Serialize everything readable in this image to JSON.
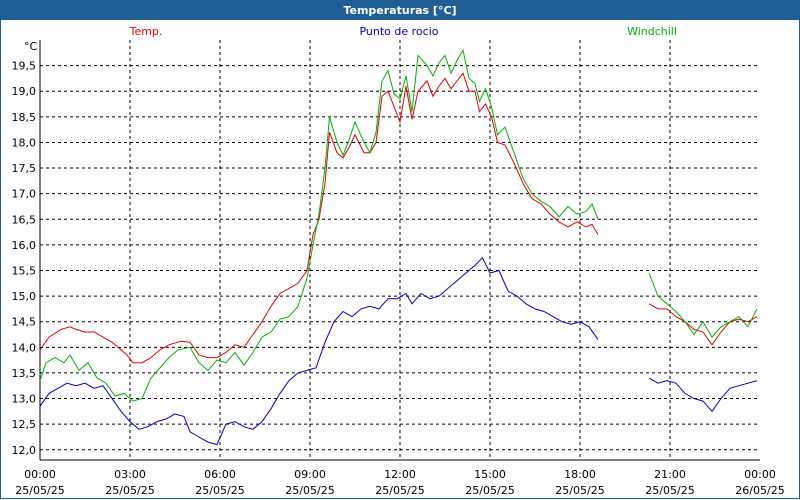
{
  "window": {
    "title": "Temperaturas [°C]"
  },
  "chart_data": {
    "type": "line",
    "title": "Temperaturas [°C]",
    "ylabel": "°C",
    "ylim": [
      11.8,
      20.0
    ],
    "y_ticks": [
      12.0,
      12.5,
      13.0,
      13.5,
      14.0,
      14.5,
      15.0,
      15.5,
      16.0,
      16.5,
      17.0,
      17.5,
      18.0,
      18.5,
      19.0,
      19.5
    ],
    "y_tick_labels": [
      "12,0",
      "12,5",
      "13,0",
      "13,5",
      "14,0",
      "14,5",
      "15,0",
      "15,5",
      "16,0",
      "16,5",
      "17,0",
      "17,5",
      "18,0",
      "18,5",
      "19,0",
      "19,5"
    ],
    "xlim": [
      0,
      24
    ],
    "x_ticks": [
      {
        "h": 0,
        "time": "00:00",
        "date": "25/05/25"
      },
      {
        "h": 3,
        "time": "03:00",
        "date": "25/05/25"
      },
      {
        "h": 6,
        "time": "06:00",
        "date": "25/05/25"
      },
      {
        "h": 9,
        "time": "09:00",
        "date": "25/05/25"
      },
      {
        "h": 12,
        "time": "12:00",
        "date": "25/05/25"
      },
      {
        "h": 15,
        "time": "15:00",
        "date": "25/05/25"
      },
      {
        "h": 18,
        "time": "18:00",
        "date": "25/05/25"
      },
      {
        "h": 21,
        "time": "21:00",
        "date": "25/05/25"
      },
      {
        "h": 24,
        "time": "00:00",
        "date": "26/05/25"
      }
    ],
    "grid": true,
    "legend_position": "top",
    "series": [
      {
        "name": "Temp.",
        "color": "#e00000",
        "segments": [
          [
            [
              0,
              13.95
            ],
            [
              0.3,
              14.2
            ],
            [
              0.7,
              14.35
            ],
            [
              1.0,
              14.4
            ],
            [
              1.2,
              14.35
            ],
            [
              1.5,
              14.3
            ],
            [
              1.8,
              14.3
            ],
            [
              2.1,
              14.2
            ],
            [
              2.4,
              14.1
            ],
            [
              2.6,
              14.0
            ],
            [
              2.9,
              13.85
            ],
            [
              3.1,
              13.7
            ],
            [
              3.4,
              13.7
            ],
            [
              3.7,
              13.8
            ],
            [
              4.0,
              13.95
            ],
            [
              4.3,
              14.05
            ],
            [
              4.7,
              14.12
            ],
            [
              5.0,
              14.1
            ],
            [
              5.3,
              13.85
            ],
            [
              5.6,
              13.8
            ],
            [
              5.9,
              13.8
            ],
            [
              6.2,
              13.9
            ],
            [
              6.5,
              14.05
            ],
            [
              6.8,
              14.0
            ],
            [
              7.1,
              14.25
            ],
            [
              7.4,
              14.5
            ],
            [
              7.7,
              14.8
            ],
            [
              8.0,
              15.05
            ],
            [
              8.3,
              15.15
            ],
            [
              8.6,
              15.25
            ],
            [
              8.9,
              15.5
            ],
            [
              9.1,
              16.2
            ],
            [
              9.3,
              16.5
            ],
            [
              9.5,
              17.2
            ],
            [
              9.65,
              18.2
            ],
            [
              9.9,
              17.8
            ],
            [
              10.1,
              17.7
            ],
            [
              10.3,
              17.9
            ],
            [
              10.5,
              18.15
            ],
            [
              10.8,
              17.8
            ],
            [
              11.0,
              17.8
            ],
            [
              11.2,
              18.0
            ],
            [
              11.4,
              18.9
            ],
            [
              11.6,
              19.0
            ],
            [
              11.8,
              18.7
            ],
            [
              12.0,
              18.4
            ],
            [
              12.2,
              19.1
            ],
            [
              12.4,
              18.45
            ],
            [
              12.6,
              19.0
            ],
            [
              12.9,
              19.2
            ],
            [
              13.1,
              18.9
            ],
            [
              13.3,
              19.1
            ],
            [
              13.5,
              19.25
            ],
            [
              13.7,
              19.05
            ],
            [
              13.9,
              19.2
            ],
            [
              14.1,
              19.35
            ],
            [
              14.3,
              19.0
            ],
            [
              14.5,
              19.0
            ],
            [
              14.65,
              18.6
            ],
            [
              14.85,
              18.75
            ],
            [
              15.05,
              18.5
            ],
            [
              15.25,
              18.0
            ],
            [
              15.5,
              17.95
            ],
            [
              15.8,
              17.6
            ],
            [
              16.1,
              17.2
            ],
            [
              16.4,
              16.9
            ],
            [
              16.7,
              16.8
            ],
            [
              17.0,
              16.6
            ],
            [
              17.3,
              16.45
            ],
            [
              17.6,
              16.35
            ],
            [
              17.9,
              16.45
            ],
            [
              18.2,
              16.35
            ],
            [
              18.4,
              16.4
            ],
            [
              18.6,
              16.2
            ]
          ],
          [
            [
              20.3,
              14.85
            ],
            [
              20.6,
              14.75
            ],
            [
              20.9,
              14.75
            ],
            [
              21.2,
              14.6
            ],
            [
              21.5,
              14.5
            ],
            [
              21.8,
              14.35
            ],
            [
              22.1,
              14.3
            ],
            [
              22.4,
              14.05
            ],
            [
              22.7,
              14.3
            ],
            [
              23.0,
              14.5
            ],
            [
              23.3,
              14.55
            ],
            [
              23.6,
              14.5
            ],
            [
              23.9,
              14.6
            ]
          ]
        ]
      },
      {
        "name": "Punto de rocio",
        "color": "#0000c8",
        "segments": [
          [
            [
              0,
              12.85
            ],
            [
              0.3,
              13.1
            ],
            [
              0.6,
              13.2
            ],
            [
              0.9,
              13.3
            ],
            [
              1.2,
              13.25
            ],
            [
              1.5,
              13.3
            ],
            [
              1.8,
              13.2
            ],
            [
              2.1,
              13.25
            ],
            [
              2.4,
              13.0
            ],
            [
              2.7,
              12.75
            ],
            [
              3.0,
              12.55
            ],
            [
              3.3,
              12.4
            ],
            [
              3.6,
              12.45
            ],
            [
              3.9,
              12.55
            ],
            [
              4.2,
              12.6
            ],
            [
              4.5,
              12.7
            ],
            [
              4.8,
              12.65
            ],
            [
              5.0,
              12.35
            ],
            [
              5.3,
              12.25
            ],
            [
              5.6,
              12.15
            ],
            [
              5.9,
              12.1
            ],
            [
              6.2,
              12.5
            ],
            [
              6.5,
              12.55
            ],
            [
              6.8,
              12.45
            ],
            [
              7.1,
              12.4
            ],
            [
              7.4,
              12.55
            ],
            [
              7.7,
              12.8
            ],
            [
              8.0,
              13.1
            ],
            [
              8.3,
              13.35
            ],
            [
              8.6,
              13.5
            ],
            [
              8.9,
              13.55
            ],
            [
              9.2,
              13.6
            ],
            [
              9.5,
              14.1
            ],
            [
              9.8,
              14.5
            ],
            [
              10.1,
              14.7
            ],
            [
              10.4,
              14.6
            ],
            [
              10.7,
              14.75
            ],
            [
              11.0,
              14.8
            ],
            [
              11.3,
              14.75
            ],
            [
              11.6,
              14.95
            ],
            [
              11.9,
              14.95
            ],
            [
              12.2,
              15.05
            ],
            [
              12.4,
              14.85
            ],
            [
              12.7,
              15.05
            ],
            [
              13.0,
              14.95
            ],
            [
              13.3,
              15.0
            ],
            [
              13.6,
              15.15
            ],
            [
              13.9,
              15.3
            ],
            [
              14.2,
              15.45
            ],
            [
              14.5,
              15.6
            ],
            [
              14.75,
              15.75
            ],
            [
              15.0,
              15.45
            ],
            [
              15.3,
              15.5
            ],
            [
              15.6,
              15.1
            ],
            [
              15.9,
              15.0
            ],
            [
              16.2,
              14.85
            ],
            [
              16.5,
              14.75
            ],
            [
              16.8,
              14.7
            ],
            [
              17.1,
              14.6
            ],
            [
              17.4,
              14.5
            ],
            [
              17.7,
              14.45
            ],
            [
              18.0,
              14.5
            ],
            [
              18.3,
              14.4
            ],
            [
              18.6,
              14.15
            ]
          ],
          [
            [
              20.3,
              13.4
            ],
            [
              20.6,
              13.3
            ],
            [
              20.9,
              13.35
            ],
            [
              21.2,
              13.3
            ],
            [
              21.5,
              13.1
            ],
            [
              21.8,
              13.0
            ],
            [
              22.1,
              12.95
            ],
            [
              22.4,
              12.75
            ],
            [
              22.7,
              13.0
            ],
            [
              23.0,
              13.2
            ],
            [
              23.3,
              13.25
            ],
            [
              23.6,
              13.3
            ],
            [
              23.9,
              13.35
            ]
          ]
        ]
      },
      {
        "name": "Windchill",
        "color": "#00b000",
        "segments": [
          [
            [
              0,
              13.35
            ],
            [
              0.2,
              13.7
            ],
            [
              0.5,
              13.8
            ],
            [
              0.8,
              13.7
            ],
            [
              1.0,
              13.85
            ],
            [
              1.3,
              13.55
            ],
            [
              1.6,
              13.7
            ],
            [
              1.9,
              13.4
            ],
            [
              2.2,
              13.3
            ],
            [
              2.5,
              13.05
            ],
            [
              2.8,
              13.1
            ],
            [
              3.1,
              12.95
            ],
            [
              3.4,
              13.0
            ],
            [
              3.7,
              13.4
            ],
            [
              4.0,
              13.6
            ],
            [
              4.3,
              13.8
            ],
            [
              4.6,
              13.95
            ],
            [
              5.0,
              14.0
            ],
            [
              5.3,
              13.7
            ],
            [
              5.6,
              13.55
            ],
            [
              5.9,
              13.75
            ],
            [
              6.2,
              13.7
            ],
            [
              6.5,
              13.9
            ],
            [
              6.8,
              13.65
            ],
            [
              7.1,
              13.9
            ],
            [
              7.4,
              14.2
            ],
            [
              7.7,
              14.3
            ],
            [
              8.0,
              14.55
            ],
            [
              8.3,
              14.6
            ],
            [
              8.6,
              14.8
            ],
            [
              8.9,
              15.35
            ],
            [
              9.1,
              16.0
            ],
            [
              9.3,
              16.6
            ],
            [
              9.5,
              17.5
            ],
            [
              9.65,
              18.5
            ],
            [
              9.9,
              18.0
            ],
            [
              10.1,
              17.75
            ],
            [
              10.3,
              18.05
            ],
            [
              10.5,
              18.4
            ],
            [
              10.8,
              18.0
            ],
            [
              11.0,
              17.8
            ],
            [
              11.2,
              18.2
            ],
            [
              11.4,
              19.2
            ],
            [
              11.6,
              19.4
            ],
            [
              11.8,
              18.95
            ],
            [
              12.0,
              18.85
            ],
            [
              12.2,
              19.3
            ],
            [
              12.4,
              18.6
            ],
            [
              12.6,
              19.7
            ],
            [
              12.9,
              19.5
            ],
            [
              13.1,
              19.3
            ],
            [
              13.3,
              19.55
            ],
            [
              13.5,
              19.7
            ],
            [
              13.7,
              19.35
            ],
            [
              13.9,
              19.6
            ],
            [
              14.1,
              19.8
            ],
            [
              14.3,
              19.25
            ],
            [
              14.5,
              19.15
            ],
            [
              14.65,
              18.8
            ],
            [
              14.85,
              19.05
            ],
            [
              15.05,
              18.7
            ],
            [
              15.25,
              18.15
            ],
            [
              15.5,
              18.3
            ],
            [
              15.8,
              17.8
            ],
            [
              16.1,
              17.3
            ],
            [
              16.4,
              17.0
            ],
            [
              16.7,
              16.85
            ],
            [
              17.0,
              16.75
            ],
            [
              17.3,
              16.55
            ],
            [
              17.6,
              16.75
            ],
            [
              17.9,
              16.6
            ],
            [
              18.2,
              16.65
            ],
            [
              18.4,
              16.8
            ],
            [
              18.6,
              16.5
            ]
          ],
          [
            [
              20.3,
              15.45
            ],
            [
              20.6,
              15.0
            ],
            [
              20.9,
              14.85
            ],
            [
              21.2,
              14.7
            ],
            [
              21.5,
              14.5
            ],
            [
              21.8,
              14.25
            ],
            [
              22.1,
              14.5
            ],
            [
              22.4,
              14.2
            ],
            [
              22.7,
              14.4
            ],
            [
              23.0,
              14.5
            ],
            [
              23.3,
              14.6
            ],
            [
              23.6,
              14.4
            ],
            [
              23.9,
              14.75
            ]
          ]
        ]
      }
    ]
  }
}
